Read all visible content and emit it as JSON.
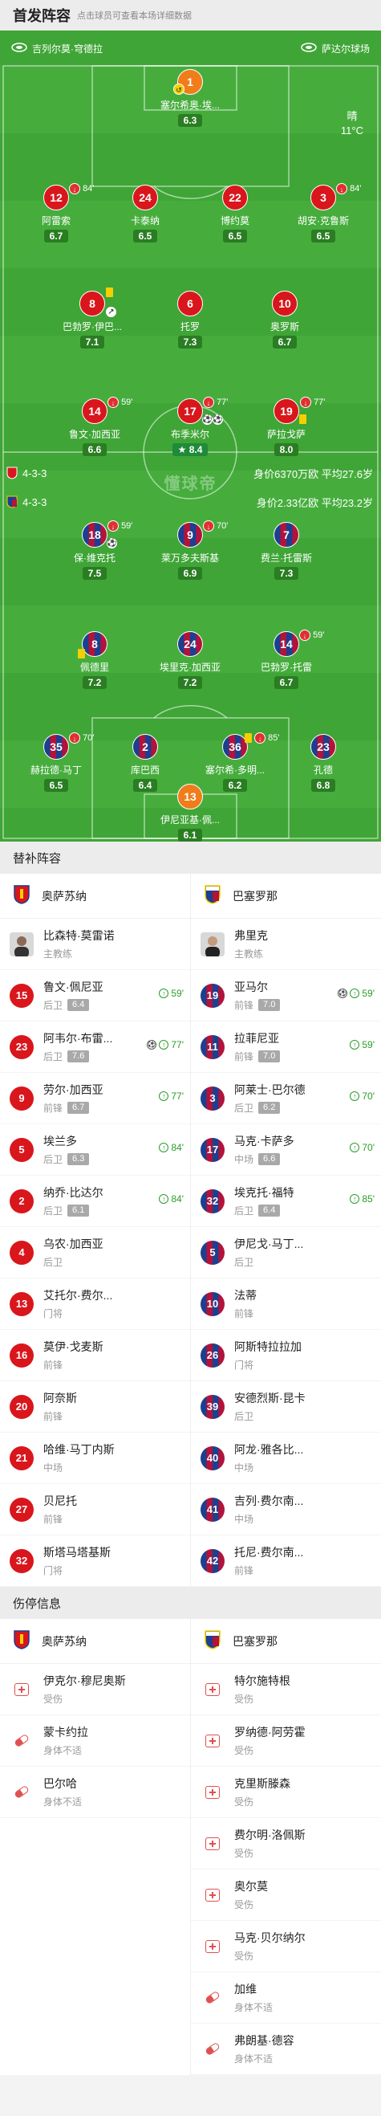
{
  "header": {
    "title": "首发阵容",
    "subtitle": "点击球员可查看本场详细数据"
  },
  "venue": {
    "home_stadium": "吉列尔莫·穹德拉",
    "away_stadium": "萨达尔球场"
  },
  "weather": {
    "condition": "晴",
    "temp": "11°C"
  },
  "watermark": "懂球帝",
  "home_formation": {
    "formation": "4-3-3",
    "summary": "身价6370万欧 平均27.6岁"
  },
  "away_formation": {
    "formation": "4-3-3",
    "summary": "身价2.33亿欧 平均23.2岁"
  },
  "home_players": [
    {
      "num": "1",
      "name": "塞尔希奥·埃...",
      "rating": "6.3"
    },
    {
      "num": "12",
      "name": "阿雷索",
      "rating": "6.7",
      "sub": "84'"
    },
    {
      "num": "24",
      "name": "卡泰纳",
      "rating": "6.5"
    },
    {
      "num": "22",
      "name": "博约莫",
      "rating": "6.5"
    },
    {
      "num": "3",
      "name": "胡安·克鲁斯",
      "rating": "6.5",
      "sub": "84'"
    },
    {
      "num": "8",
      "name": "巴勃罗·伊巴...",
      "rating": "7.1"
    },
    {
      "num": "6",
      "name": "托罗",
      "rating": "7.3"
    },
    {
      "num": "10",
      "name": "奥罗斯",
      "rating": "6.7"
    },
    {
      "num": "14",
      "name": "鲁文·加西亚",
      "rating": "6.6",
      "sub": "59'"
    },
    {
      "num": "17",
      "name": "布季米尔",
      "rating": "8.4",
      "sub": "77'"
    },
    {
      "num": "19",
      "name": "萨拉戈萨",
      "rating": "8.0",
      "sub": "77'"
    }
  ],
  "away_players": [
    {
      "num": "18",
      "name": "保·维克托",
      "rating": "7.5",
      "sub": "59'"
    },
    {
      "num": "9",
      "name": "莱万多夫斯基",
      "rating": "6.9",
      "sub": "70'"
    },
    {
      "num": "7",
      "name": "费兰·托雷斯",
      "rating": "7.3"
    },
    {
      "num": "8",
      "name": "佩德里",
      "rating": "7.2"
    },
    {
      "num": "24",
      "name": "埃里克·加西亚",
      "rating": "7.2"
    },
    {
      "num": "14",
      "name": "巴勃罗·托雷",
      "rating": "6.7",
      "sub": "59'"
    },
    {
      "num": "35",
      "name": "赫拉德·马丁",
      "rating": "6.5",
      "sub": "70'"
    },
    {
      "num": "2",
      "name": "库巴西",
      "rating": "6.4"
    },
    {
      "num": "36",
      "name": "塞尔希·多明...",
      "rating": "6.2",
      "sub": "85'"
    },
    {
      "num": "23",
      "name": "孔德",
      "rating": "6.8"
    },
    {
      "num": "13",
      "name": "伊尼亚基·佩...",
      "rating": "6.1"
    }
  ],
  "subs_section": {
    "title": "替补阵容"
  },
  "home_team": {
    "name": "奥萨苏纳"
  },
  "away_team": {
    "name": "巴塞罗那"
  },
  "home_coach": {
    "name": "比森特·莫雷诺",
    "role": "主教练"
  },
  "away_coach": {
    "name": "弗里克",
    "role": "主教练"
  },
  "home_subs": [
    {
      "num": "15",
      "name": "鲁文·佩尼亚",
      "pos": "后卫",
      "rating": "6.4",
      "in": "59'"
    },
    {
      "num": "23",
      "name": "阿韦尔·布雷...",
      "pos": "后卫",
      "rating": "7.6",
      "in": "77'",
      "goal": true
    },
    {
      "num": "9",
      "name": "劳尔·加西亚",
      "pos": "前锋",
      "rating": "6.7",
      "in": "77'"
    },
    {
      "num": "5",
      "name": "埃兰多",
      "pos": "后卫",
      "rating": "6.3",
      "in": "84'"
    },
    {
      "num": "2",
      "name": "纳乔·比达尔",
      "pos": "后卫",
      "rating": "6.1",
      "in": "84'"
    },
    {
      "num": "4",
      "name": "乌农·加西亚",
      "pos": "后卫"
    },
    {
      "num": "13",
      "name": "艾托尔·费尔...",
      "pos": "门将"
    },
    {
      "num": "16",
      "name": "莫伊·戈麦斯",
      "pos": "前锋"
    },
    {
      "num": "20",
      "name": "阿奈斯",
      "pos": "前锋"
    },
    {
      "num": "21",
      "name": "哈维·马丁内斯",
      "pos": "中场"
    },
    {
      "num": "27",
      "name": "贝尼托",
      "pos": "前锋"
    },
    {
      "num": "32",
      "name": "斯塔马塔基斯",
      "pos": "门将"
    }
  ],
  "away_subs": [
    {
      "num": "19",
      "name": "亚马尔",
      "pos": "前锋",
      "rating": "7.0",
      "in": "59'",
      "goal": true
    },
    {
      "num": "11",
      "name": "拉菲尼亚",
      "pos": "前锋",
      "rating": "7.0",
      "in": "59'"
    },
    {
      "num": "3",
      "name": "阿莱士·巴尔德",
      "pos": "后卫",
      "rating": "6.2",
      "in": "70'"
    },
    {
      "num": "17",
      "name": "马克·卡萨多",
      "pos": "中场",
      "rating": "6.6",
      "in": "70'"
    },
    {
      "num": "32",
      "name": "埃克托·福特",
      "pos": "后卫",
      "rating": "6.4",
      "in": "85'"
    },
    {
      "num": "5",
      "name": "伊尼戈·马丁...",
      "pos": "后卫"
    },
    {
      "num": "10",
      "name": "法蒂",
      "pos": "前锋"
    },
    {
      "num": "26",
      "name": "阿斯特拉拉加",
      "pos": "门将"
    },
    {
      "num": "39",
      "name": "安德烈斯·昆卡",
      "pos": "后卫"
    },
    {
      "num": "40",
      "name": "阿龙·雅各比...",
      "pos": "中场"
    },
    {
      "num": "41",
      "name": "吉列·费尔南...",
      "pos": "中场"
    },
    {
      "num": "42",
      "name": "托尼·费尔南...",
      "pos": "前锋"
    }
  ],
  "injury_section": {
    "title": "伤停信息"
  },
  "home_injuries": [
    {
      "name": "伊克尔·穆尼奥斯",
      "status": "受伤",
      "icon": "cross"
    },
    {
      "name": "蒙卡约拉",
      "status": "身体不适",
      "icon": "pill"
    },
    {
      "name": "巴尔哈",
      "status": "身体不适",
      "icon": "pill"
    }
  ],
  "away_injuries": [
    {
      "name": "特尔施特根",
      "status": "受伤",
      "icon": "cross"
    },
    {
      "name": "罗纳德·阿劳霍",
      "status": "受伤",
      "icon": "cross"
    },
    {
      "name": "克里斯滕森",
      "status": "受伤",
      "icon": "cross"
    },
    {
      "name": "费尔明·洛佩斯",
      "status": "受伤",
      "icon": "cross"
    },
    {
      "name": "奥尔莫",
      "status": "受伤",
      "icon": "cross"
    },
    {
      "name": "马克·贝尔纳尔",
      "status": "受伤",
      "icon": "cross"
    },
    {
      "name": "加维",
      "status": "身体不适",
      "icon": "pill"
    },
    {
      "name": "弗朗基·德容",
      "status": "身体不适",
      "icon": "pill"
    }
  ],
  "colors": {
    "pitch": "#3fa536",
    "home": "#d9161c",
    "keeper": "#f07c1a",
    "away_blue": "#1d3f8f",
    "away_red": "#b3123b"
  }
}
